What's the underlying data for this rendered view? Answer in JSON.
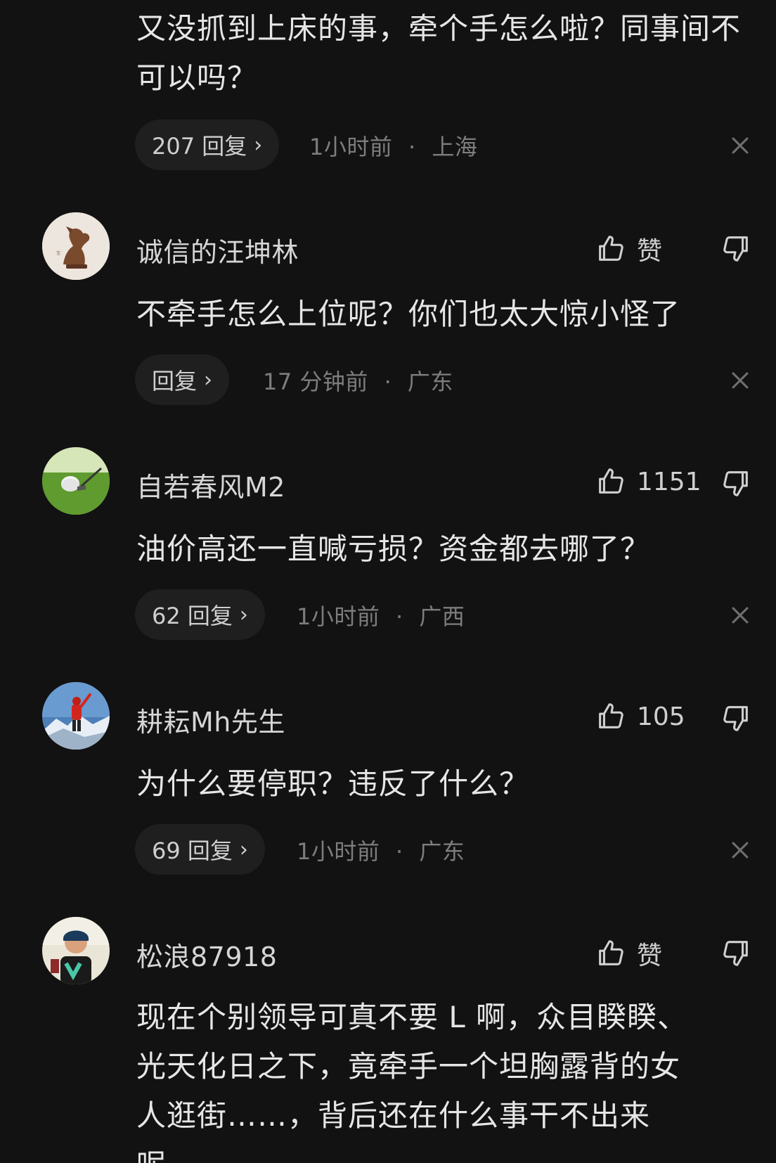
{
  "comments": [
    {
      "text": "又没抓到上床的事，牵个手怎么啦？同事间不可以吗？",
      "replies": "207 回复",
      "time": "1小时前",
      "location": "上海"
    },
    {
      "username": "诚信的汪坤林",
      "likes": "赞",
      "text": "不牵手怎么上位呢？你们也太大惊小怪了",
      "replies": "回复",
      "time": "17 分钟前",
      "location": "广东"
    },
    {
      "username": "自若春风M2",
      "likes": "1151",
      "text": "油价高还一直喊亏损？资金都去哪了？",
      "replies": "62 回复",
      "time": "1小时前",
      "location": "广西"
    },
    {
      "username": "耕耘Mh先生",
      "likes": "105",
      "text": "为什么要停职？违反了什么？",
      "replies": "69 回复",
      "time": "1小时前",
      "location": "广东"
    },
    {
      "username": "松浪87918",
      "likes": "赞",
      "text_lines": [
        "现在个别领导可真不要 L 啊，众目睽睽、",
        "光天化日之下，竟牵手一个坦胸露背的女",
        "人逛街……，背后还在什么事干不出来",
        "呢"
      ]
    }
  ],
  "meta_separator": "·",
  "icons": {
    "like": "thumbs-up-icon",
    "dislike": "thumbs-down-icon",
    "close": "close-icon",
    "chevron": "chevron-right-icon"
  },
  "colors": {
    "background": "#121212",
    "text": "#e6e6e6",
    "muted": "#7d7d7d",
    "pill": "#1f1f1f"
  }
}
